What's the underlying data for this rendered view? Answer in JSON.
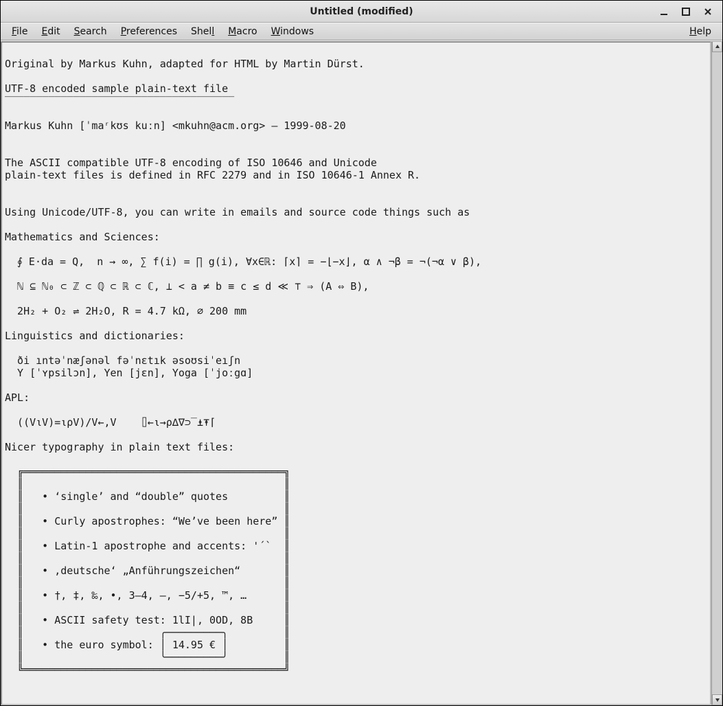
{
  "window": {
    "title": "Untitled (modified)"
  },
  "menubar": {
    "items": [
      {
        "u": "F",
        "rest": "ile"
      },
      {
        "u": "E",
        "rest": "dit"
      },
      {
        "u": "S",
        "rest": "earch"
      },
      {
        "u": "P",
        "rest": "references"
      },
      {
        "u": "S",
        "rest": "hell",
        "noU": true,
        "pre": "Shel",
        "ufull": "Shell"
      },
      {
        "u": "M",
        "rest": "acro"
      },
      {
        "u": "W",
        "rest": "indows"
      }
    ],
    "help": {
      "u": "H",
      "rest": "elp"
    }
  },
  "editor": {
    "text": "\nOriginal by Markus Kuhn, adapted for HTML by Martin Dürst.\n\nUTF-8 encoded sample plain-text file\n‾‾‾‾‾‾‾‾‾‾‾‾‾‾‾‾‾‾‾‾‾‾‾‾‾‾‾‾‾‾‾‾‾‾‾‾‾\n\nMarkus Kuhn [ˈmaʳkʊs kuːn] <mkuhn@acm.org> — 1999-08-20\n\n\nThe ASCII compatible UTF-8 encoding of ISO 10646 and Unicode\nplain-text files is defined in RFC 2279 and in ISO 10646-1 Annex R.\n\n\nUsing Unicode/UTF-8, you can write in emails and source code things such as\n\nMathematics and Sciences:\n\n  ∮ E·da = Q,  n → ∞, ∑ f(i) = ∏ g(i), ∀x∈ℝ: ⌈x⌉ = −⌊−x⌋, α ∧ ¬β = ¬(¬α ∨ β),\n\n  ℕ ⊆ ℕ₀ ⊂ ℤ ⊂ ℚ ⊂ ℝ ⊂ ℂ, ⊥ < a ≠ b ≡ c ≤ d ≪ ⊤ ⇒ (A ⇔ B),\n\n  2H₂ + O₂ ⇌ 2H₂O, R = 4.7 kΩ, ⌀ 200 mm\n\nLinguistics and dictionaries:\n\n  ði ıntəˈnæʃənəl fəˈnɛtık əsoʊsiˈeıʃn\n  Y [ˈʏpsilɔn], Yen [jɛn], Yoga [ˈjoːgɑ]\n\nAPL:\n\n  ((V⍳V)=⍳ρV)/V←,V    ⌷←⍳→ρ∆∇⊃‾⍎⍕⌈\n\nNicer typography in plain text files:\n\n  ╔══════════════════════════════════════════╗\n  ║                                          ║\n  ║   • ‘single’ and “double” quotes         ║\n  ║                                          ║\n  ║   • Curly apostrophes: “We’ve been here” ║\n  ║                                          ║\n  ║   • Latin-1 apostrophe and accents: '´`  ║\n  ║                                          ║\n  ║   • ‚deutsche‘ „Anführungszeichen“       ║\n  ║                                          ║\n  ║   • †, ‡, ‰, •, 3–4, —, −5/+5, ™, …      ║\n  ║                                          ║\n  ║   • ASCII safety test: 1lI|, 0OD, 8B     ║\n  ║                      ╭─────────╮         ║\n  ║   • the euro symbol: │ 14.95 € │         ║\n  ║                      ╰─────────╯         ║\n  ╚══════════════════════════════════════════╝\n"
  }
}
